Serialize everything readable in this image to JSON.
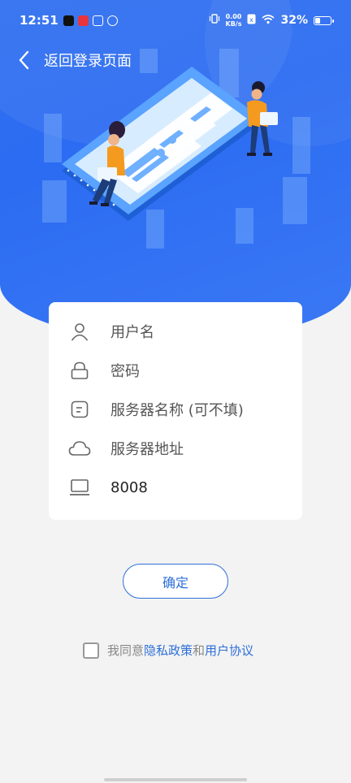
{
  "status_bar": {
    "time": "12:51",
    "net_speed_value": "0.00",
    "net_speed_unit": "KB/s",
    "battery": "32%",
    "battery_level": 0.32
  },
  "nav": {
    "back_label": "返回登录页面"
  },
  "form": {
    "username_placeholder": "用户名",
    "password_placeholder": "密码",
    "server_name_placeholder": "服务器名称 (可不填)",
    "server_address_placeholder": "服务器地址",
    "port_value": "8008"
  },
  "actions": {
    "confirm_label": "确定"
  },
  "agreement": {
    "prefix": "我同意",
    "privacy_link": "隐私政策",
    "and": "和",
    "user_agreement_link": "用户协议"
  },
  "colors": {
    "hero_blue": "#2f6ff0",
    "accent": "#2e6fd8",
    "background": "#f3f3f3",
    "figure_orange": "#f49a1f"
  },
  "icons": {
    "back": "chevron-left-icon",
    "username": "user-icon",
    "password": "lock-icon",
    "server_name": "note-icon",
    "server_address": "cloud-icon",
    "port": "laptop-icon"
  }
}
